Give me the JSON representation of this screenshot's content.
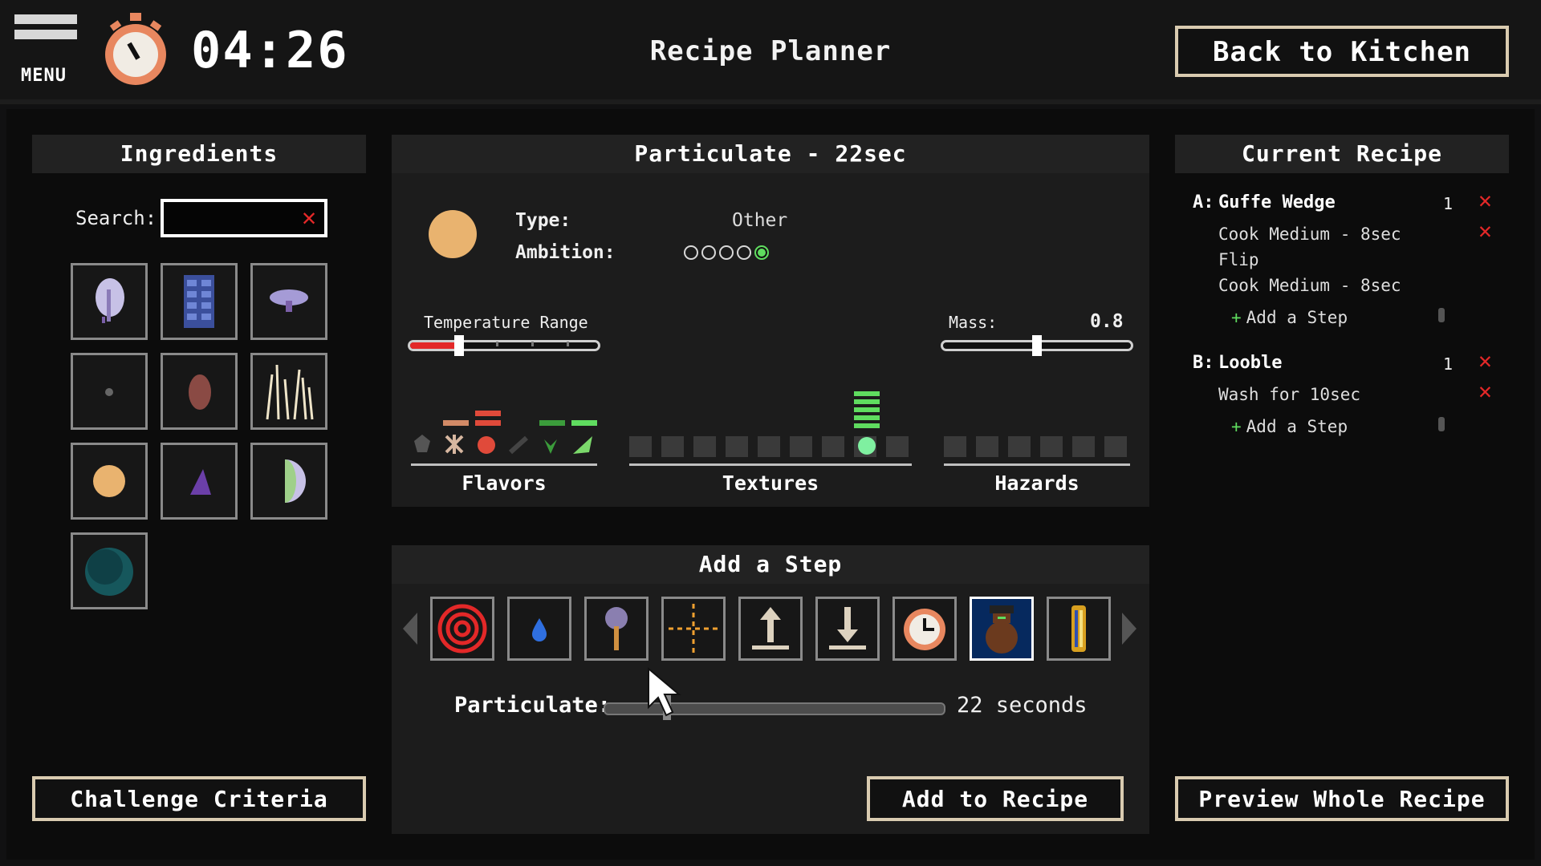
{
  "header": {
    "menu_label": "MENU",
    "timer": "04:26",
    "title": "Recipe Planner",
    "back_button": "Back to Kitchen"
  },
  "ingredients": {
    "heading": "Ingredients",
    "search_label": "Search:",
    "search_value": "",
    "search_clear_icon": "clear-x-icon",
    "challenge_button": "Challenge Criteria"
  },
  "details": {
    "heading": "Particulate - 22sec",
    "type_label": "Type:",
    "type_value": "Other",
    "ambition_label": "Ambition:",
    "ambition_level": 5,
    "ambition_max": 5,
    "temperature_label": "Temperature Range",
    "mass_label": "Mass:",
    "mass_value": "0.8",
    "groups": [
      "Flavors",
      "Textures",
      "Hazards"
    ],
    "colors": {
      "ingredient": "#e9b36f",
      "highlight": "#5fdc5f",
      "alert": "#e32828"
    }
  },
  "add_step": {
    "heading": "Add a Step",
    "steps": [
      "heat-icon",
      "water-drop-icon",
      "mallet-icon",
      "crosshair-icon",
      "raise-icon",
      "lower-icon",
      "clock-icon",
      "jar-icon",
      "tube-icon"
    ],
    "selected_step": "jar-icon",
    "particulate_label": "Particulate:",
    "particulate_value": "22 seconds",
    "add_button": "Add to Recipe"
  },
  "recipe": {
    "heading": "Current Recipe",
    "items": [
      {
        "letter": "A:",
        "name": "Guffe Wedge",
        "qty": "1",
        "steps": [
          "Cook Medium - 8sec",
          "Flip",
          "Cook Medium - 8sec"
        ],
        "add_step": "Add a Step"
      },
      {
        "letter": "B:",
        "name": "Looble",
        "qty": "1",
        "steps": [
          "Wash for 10sec"
        ],
        "add_step": "Add a Step"
      }
    ],
    "preview_button": "Preview Whole Recipe"
  }
}
